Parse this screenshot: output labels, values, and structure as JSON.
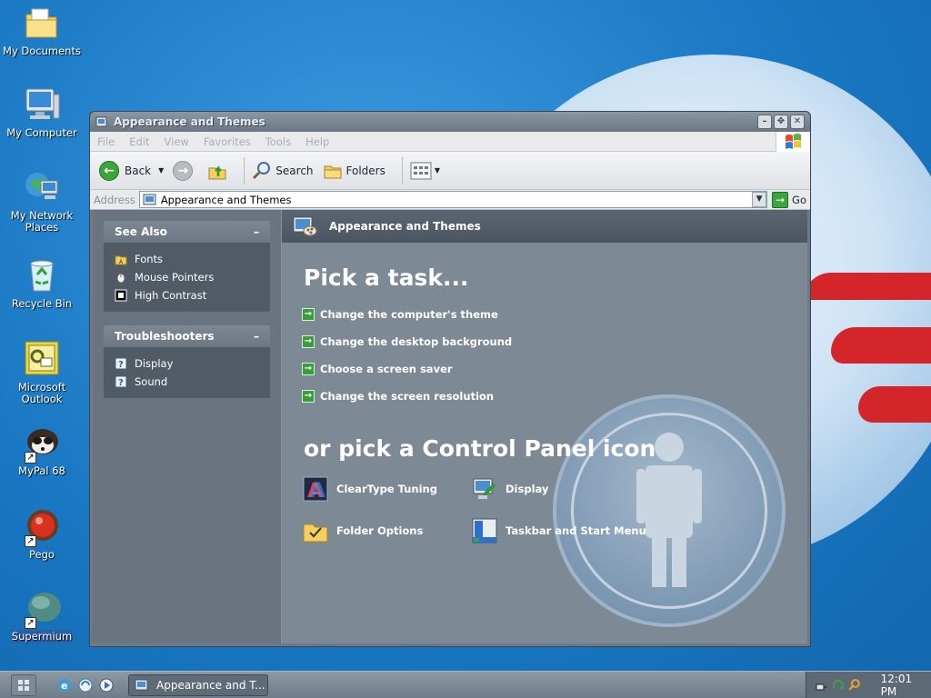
{
  "desktop": {
    "icons": [
      {
        "label": "My Documents",
        "icon": "folder-icon"
      },
      {
        "label": "My Computer",
        "icon": "computer-icon"
      },
      {
        "label": "My Network Places",
        "icon": "network-icon"
      },
      {
        "label": "Recycle Bin",
        "icon": "recycle-bin-icon"
      },
      {
        "label": "Microsoft Outlook",
        "icon": "outlook-icon"
      },
      {
        "label": "MyPal 68",
        "icon": "mypal-icon"
      },
      {
        "label": "Pego",
        "icon": "pego-icon"
      },
      {
        "label": "Supermium",
        "icon": "supermium-icon"
      }
    ]
  },
  "window": {
    "title": "Appearance and Themes",
    "menu": [
      "File",
      "Edit",
      "View",
      "Favorites",
      "Tools",
      "Help"
    ],
    "toolbar": {
      "back": "Back",
      "search": "Search",
      "folders": "Folders"
    },
    "address": {
      "label": "Address",
      "value": "Appearance and Themes",
      "go": "Go"
    },
    "see_also": {
      "title": "See Also",
      "items": [
        {
          "label": "Fonts",
          "icon": "fonts-folder-icon"
        },
        {
          "label": "Mouse Pointers",
          "icon": "mouse-icon"
        },
        {
          "label": "High Contrast",
          "icon": "high-contrast-icon"
        }
      ]
    },
    "troubleshooters": {
      "title": "Troubleshooters",
      "items": [
        {
          "label": "Display",
          "icon": "help-icon"
        },
        {
          "label": "Sound",
          "icon": "help-icon"
        }
      ]
    },
    "main": {
      "header": "Appearance and Themes",
      "pick_task": "Pick a task...",
      "tasks": [
        "Change the computer's theme",
        "Change the desktop background",
        "Choose a screen saver",
        "Change the screen resolution"
      ],
      "pick_icon": "or pick a Control Panel icon",
      "icons": [
        {
          "label": "ClearType Tuning",
          "icon": "cleartype-icon"
        },
        {
          "label": "Display",
          "icon": "display-icon"
        },
        {
          "label": "Folder Options",
          "icon": "folder-options-icon"
        },
        {
          "label": "Taskbar and Start Menu",
          "icon": "taskbar-icon"
        }
      ]
    }
  },
  "taskbar": {
    "task_button": "Appearance and T...",
    "clock": "12:01 PM"
  }
}
